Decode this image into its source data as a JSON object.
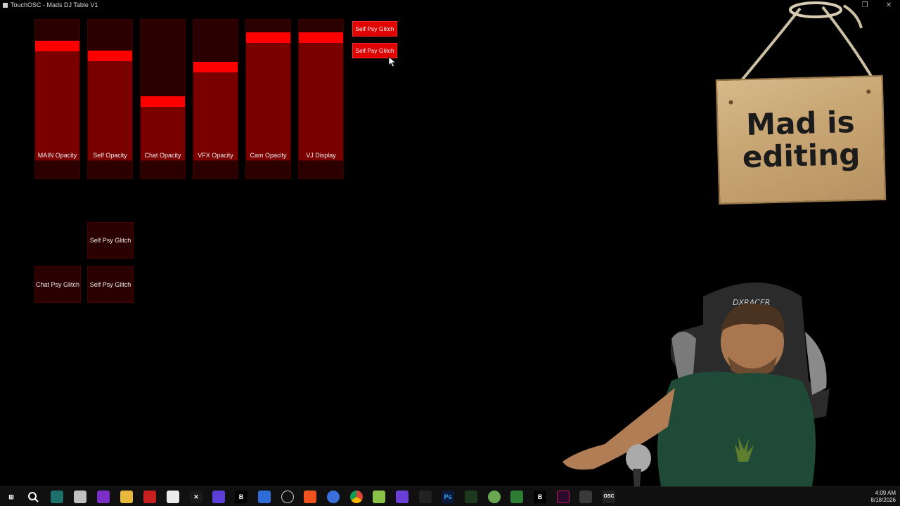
{
  "window": {
    "title": "TouchOSC - Mads DJ Table V1"
  },
  "faders": [
    {
      "label": "MAIN Opacity",
      "value": 0.9
    },
    {
      "label": "Self Opacity",
      "value": 0.82
    },
    {
      "label": "Chat Opacity",
      "value": 0.45
    },
    {
      "label": "VFX Opacity",
      "value": 0.73
    },
    {
      "label": "Cam Opacity",
      "value": 0.97
    },
    {
      "label": "VJ Display",
      "value": 0.97
    }
  ],
  "top_buttons": [
    {
      "label": "Self  Psy Glitch"
    },
    {
      "label": "Self  Psy Glitch"
    }
  ],
  "grid_buttons": [
    {
      "label": "Self  Psy Glitch"
    },
    {
      "label": "Chat Psy Glitch"
    },
    {
      "label": "Self  Psy Glitch"
    }
  ],
  "sign": {
    "line1": "Mad is",
    "line2": "editing"
  },
  "webcam": {
    "chair_brand": "DXRACER"
  },
  "taskbar": {
    "icons": [
      "windows-start-icon",
      "search-icon",
      "app-icon",
      "app-icon",
      "app-icon",
      "folder-icon",
      "voicemeeter-icon",
      "app-icon",
      "capcut-icon",
      "grid-app-icon",
      "bold-b-icon",
      "app-icon",
      "obs-icon",
      "brave-icon",
      "app-icon",
      "chrome-icon",
      "app-icon",
      "app-icon",
      "app-icon",
      "photoshop-icon",
      "app-icon",
      "app-icon",
      "app-icon",
      "b-app-icon",
      "app-icon",
      "active-app-icon",
      "osc-icon"
    ],
    "labels": {
      "b1": "B",
      "ps": "Ps",
      "b2": "B",
      "osc": "OSC"
    },
    "time": "4:09 AM",
    "date": "8/18/2026"
  },
  "colors": {
    "fader_bg": "#2a0000",
    "fader_fill": "#7a0000",
    "fader_handle": "#ff0000",
    "button_active": "#e00000"
  }
}
